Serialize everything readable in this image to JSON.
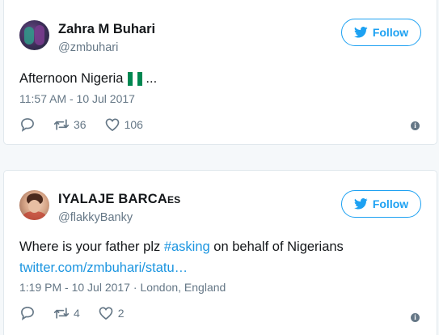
{
  "tweets": [
    {
      "user": {
        "name": "Zahra M Buhari",
        "handle": "@zmbuhari"
      },
      "follow_label": "Follow",
      "text": "Afternoon Nigeria",
      "text_suffix": "...",
      "timestamp": "11:57 AM - 10 Jul 2017",
      "retweets": "36",
      "likes": "106"
    },
    {
      "user": {
        "name": "IYALAJE BARCA",
        "name_small": "ES",
        "handle": "@flakkyBanky"
      },
      "follow_label": "Follow",
      "text_before": "Where is your father plz ",
      "hashtag": "#asking",
      "text_after": " on behalf of Nigerians",
      "link": "twitter.com/zmbuhari/statu…",
      "timestamp": "1:19 PM - 10 Jul 2017",
      "location_sep": " · ",
      "location": "London, England",
      "retweets": "4",
      "likes": "2"
    }
  ],
  "colors": {
    "accent": "#1da1f2",
    "link": "#1b95e0",
    "muted": "#657786",
    "nigeria_green": "#008751"
  },
  "icons": [
    "twitter-bird-icon",
    "reply-icon",
    "retweet-icon",
    "like-icon",
    "info-icon",
    "nigeria-flag-icon"
  ]
}
